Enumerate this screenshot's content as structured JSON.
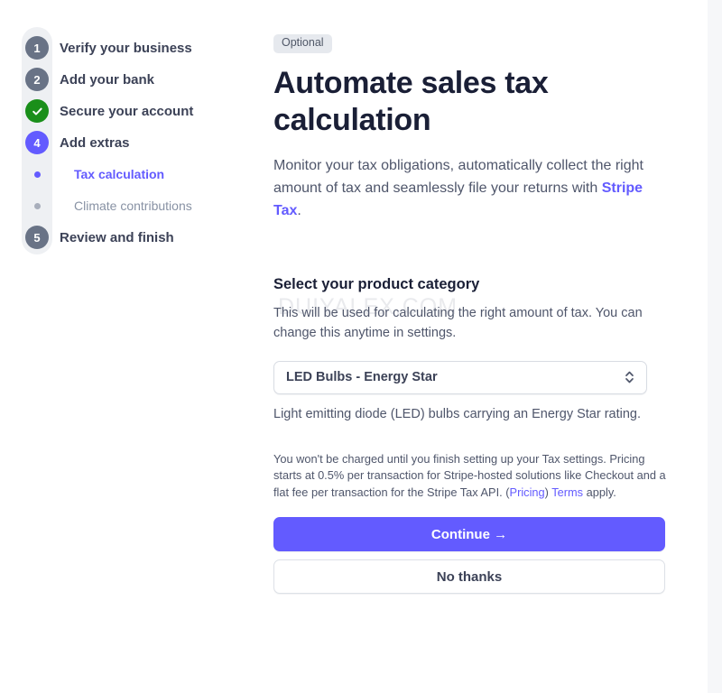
{
  "stepper": {
    "steps": [
      {
        "marker": "1",
        "type": "number-gray",
        "label": "Verify your business"
      },
      {
        "marker": "2",
        "type": "number-gray",
        "label": "Add your bank"
      },
      {
        "marker": "check",
        "type": "complete",
        "label": "Secure your account"
      },
      {
        "marker": "4",
        "type": "number-active",
        "label": "Add extras"
      },
      {
        "marker": "dot",
        "type": "sub-active",
        "label": "Tax calculation"
      },
      {
        "marker": "dot",
        "type": "sub-muted",
        "label": "Climate contributions"
      },
      {
        "marker": "5",
        "type": "number-gray",
        "label": "Review and finish"
      }
    ]
  },
  "content": {
    "badge": "Optional",
    "title": "Automate sales tax calculation",
    "lede_before": "Monitor your tax obligations, automatically collect the right amount of tax and seamlessly file your returns with ",
    "lede_link": "Stripe Tax",
    "lede_after": ".",
    "section_title": "Select your product category",
    "section_sub": "This will be used for calculating the right amount of tax. You can change this anytime in settings.",
    "category_value": "LED Bulbs - Energy Star",
    "category_options": [
      "LED Bulbs - Energy Star"
    ],
    "category_help": "Light emitting diode (LED) bulbs carrying an Energy Star rating.",
    "fineprint_before": "You won't be charged until you finish setting up your Tax settings. Pricing starts at 0.5% per transaction for Stripe-hosted solutions like Checkout and a flat fee per transaction for the Stripe Tax API. (",
    "fineprint_link_pricing": "Pricing",
    "fineprint_mid": ") ",
    "fineprint_link_terms": "Terms",
    "fineprint_after": " apply.",
    "continue_label": "Continue  →",
    "no_thanks_label": "No thanks"
  },
  "watermark": {
    "text": "DUIYALEX.COM"
  },
  "colors": {
    "accent": "#635bff",
    "complete": "#1a8f1a",
    "step_gray": "#697386",
    "heading": "#1a1f36",
    "body": "#4f566b",
    "gutter": "#f6f7f9"
  }
}
